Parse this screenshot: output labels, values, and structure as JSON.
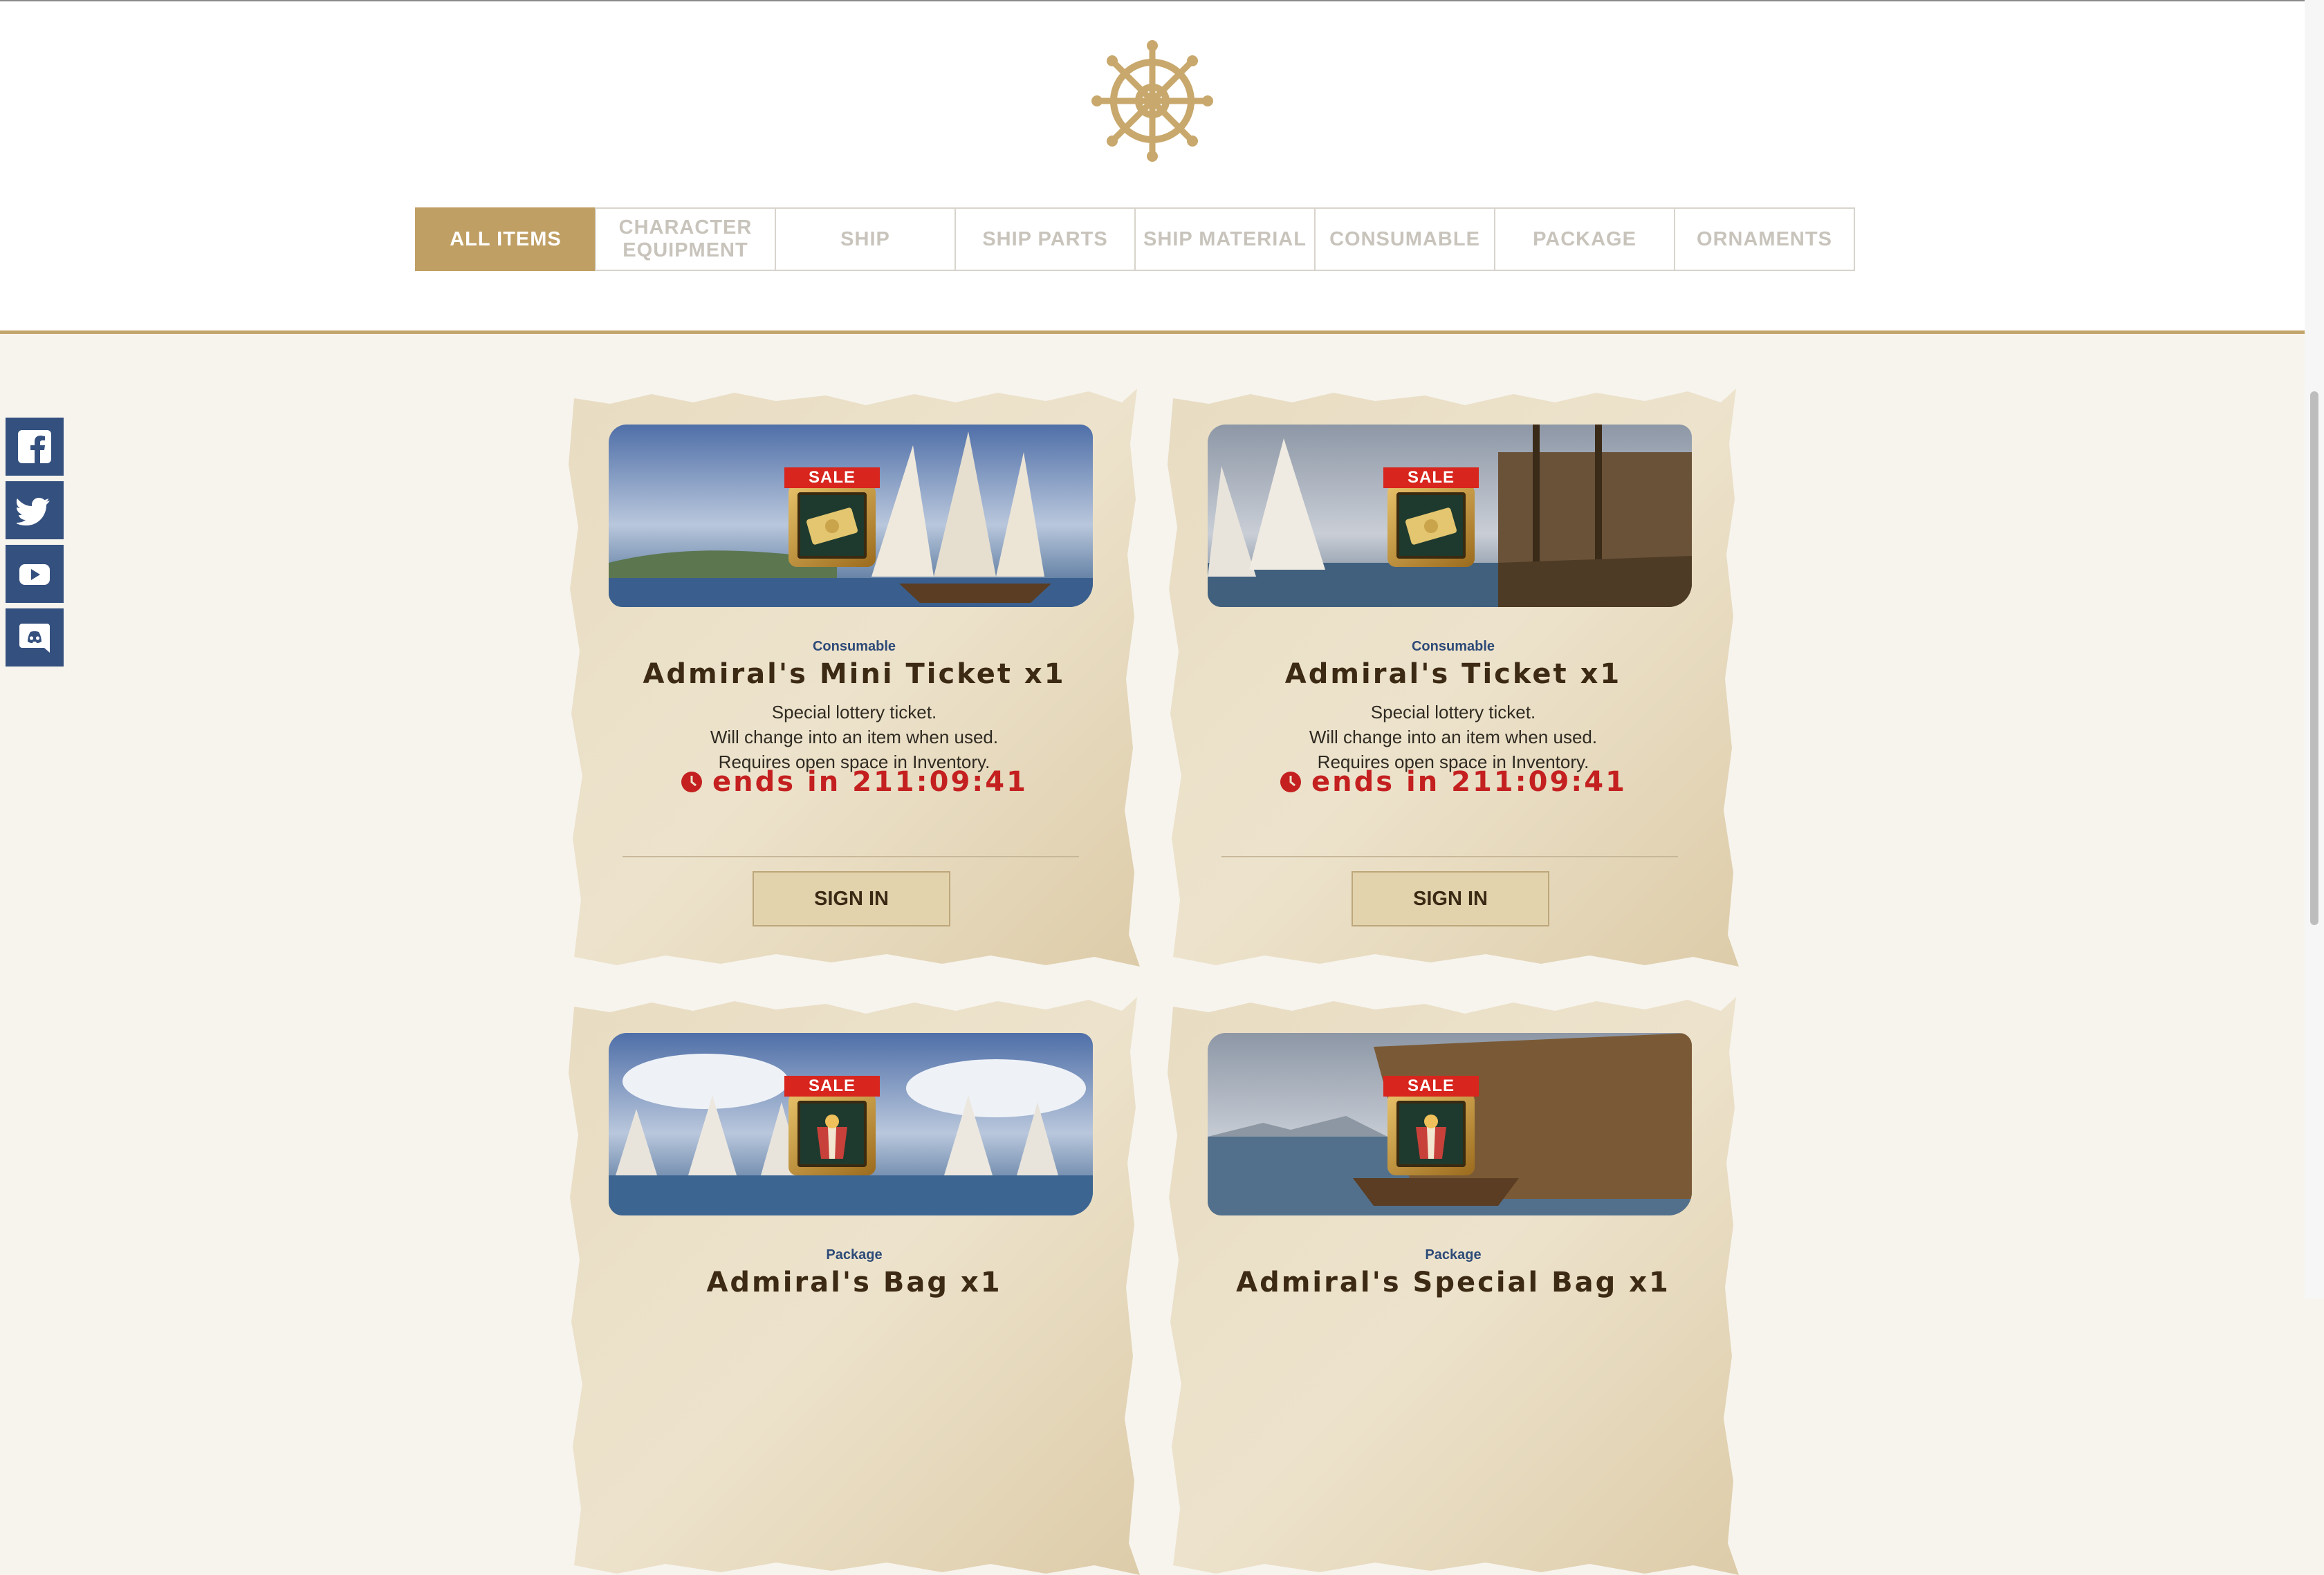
{
  "tabs": [
    {
      "label": "ALL ITEMS",
      "active": true
    },
    {
      "label": "CHARACTER EQUIPMENT",
      "active": false
    },
    {
      "label": "SHIP",
      "active": false
    },
    {
      "label": "SHIP PARTS",
      "active": false
    },
    {
      "label": "SHIP MATERIAL",
      "active": false
    },
    {
      "label": "CONSUMABLE",
      "active": false
    },
    {
      "label": "PACKAGE",
      "active": false
    },
    {
      "label": "ORNAMENTS",
      "active": false
    }
  ],
  "social": [
    "facebook-icon",
    "twitter-icon",
    "youtube-icon",
    "discord-icon"
  ],
  "items": [
    {
      "category": "Consumable",
      "name": "Admiral's Mini Ticket  x1",
      "desc": [
        "Special lottery ticket.",
        "Will change into an item when used.",
        "Requires open space in Inventory."
      ],
      "timer": "ends in 211:09:41",
      "button": "SIGN IN",
      "sale": "SALE",
      "icon": "ticket-icon"
    },
    {
      "category": "Consumable",
      "name": "Admiral's Ticket  x1",
      "desc": [
        "Special lottery ticket.",
        "Will change into an item when used.",
        "Requires open space in Inventory."
      ],
      "timer": "ends in 211:09:41",
      "button": "SIGN IN",
      "sale": "SALE",
      "icon": "ticket-icon"
    },
    {
      "category": "Package",
      "name": "Admiral's Bag  x1",
      "sale": "SALE",
      "icon": "gift-bag-icon"
    },
    {
      "category": "Package",
      "name": "Admiral's Special Bag  x1",
      "sale": "SALE",
      "icon": "gift-bag-icon"
    }
  ],
  "colors": {
    "accent": "#c09f64",
    "timer": "#c42020",
    "sale": "#d8251d",
    "social": "#34507f"
  }
}
